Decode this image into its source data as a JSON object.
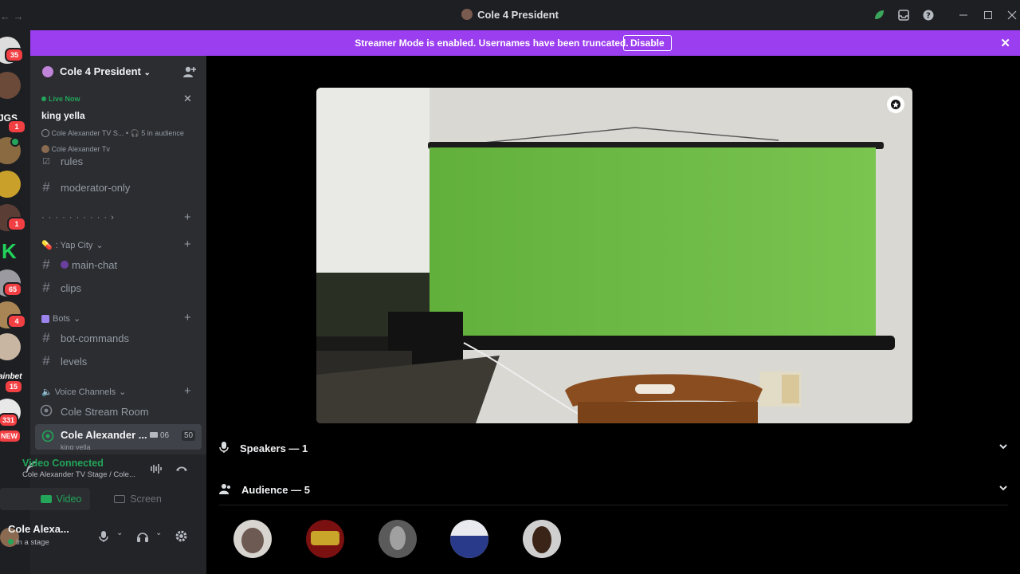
{
  "window": {
    "title": "Cole 4 President",
    "nav_arrows": "← →"
  },
  "banner": {
    "message": "Streamer Mode is enabled. Usernames have been truncated.",
    "disable_label": "Disable"
  },
  "rail": {
    "badges": [
      "35",
      "1",
      "1",
      "65",
      "4",
      "15",
      "331",
      "NEW"
    ],
    "partial_labels": [
      "JGS",
      "ainbet"
    ]
  },
  "sidebar": {
    "server_name": "Cole 4 President",
    "live": {
      "status": "Live Now",
      "title": "king yella",
      "stage": "Cole Alexander TV S...",
      "audience": "5 in audience",
      "host": "Cole Alexander Tv"
    },
    "channels_top": [
      {
        "label": "rules"
      },
      {
        "label": "moderator-only"
      }
    ],
    "dotted_category": "· · · · · · · · · ·",
    "categories": {
      "yap_city": ": Yap City",
      "bots": "Bots",
      "voice": "Voice Channels"
    },
    "yap_channels": [
      {
        "label": "main-chat"
      },
      {
        "label": "clips"
      }
    ],
    "bot_channels": [
      {
        "label": "bot-commands"
      },
      {
        "label": "levels"
      }
    ],
    "voice_channels": [
      {
        "label": "Cole Stream Room"
      },
      {
        "label": "Cole Alexander ...",
        "sub": "king yella",
        "count_a": "06",
        "count_b": "50"
      }
    ]
  },
  "voice_panel": {
    "status": "Video Connected",
    "location": "Cole Alexander TV Stage / Cole...",
    "video_label": "Video",
    "screen_label": "Screen"
  },
  "user_panel": {
    "name": "Cole Alexa...",
    "status": "In a stage"
  },
  "stage": {
    "speakers_label": "Speakers — 1",
    "audience_label": "Audience — 5"
  },
  "colors": {
    "accent_purple": "#9b3ef0",
    "connected_green": "#23a55a",
    "badge_red": "#f23f43"
  }
}
